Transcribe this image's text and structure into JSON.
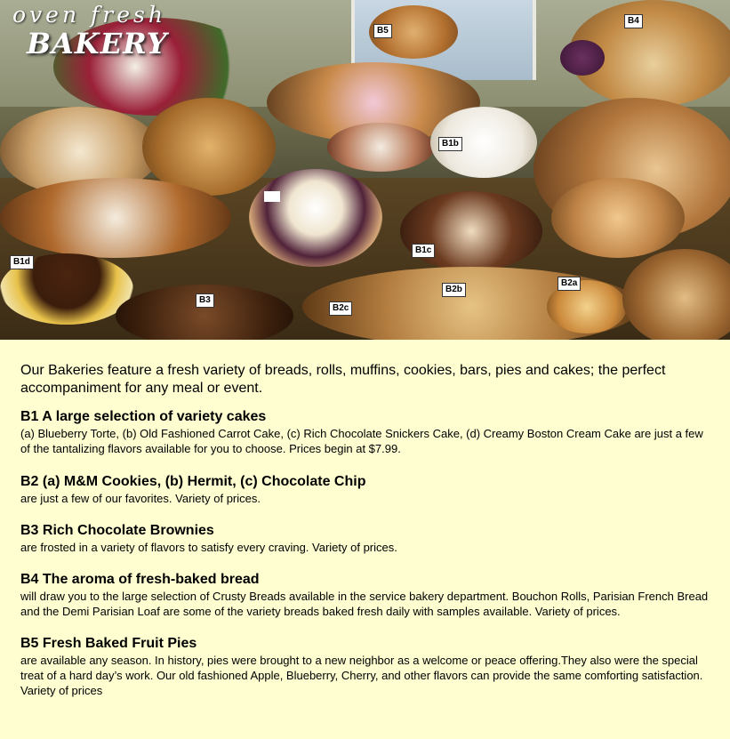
{
  "brand": {
    "line1": "oven fresh",
    "line2": "BAKERY"
  },
  "hero_labels": [
    "B5",
    "B4",
    "B1b",
    "B1c",
    "B1d",
    "B3",
    "B2c",
    "B2b",
    "B2a"
  ],
  "intro": "Our Bakeries feature a fresh variety of breads, rolls, muffins, cookies, bars, pies and cakes; the perfect accompaniment for any meal or event.",
  "sections": [
    {
      "heading": "B1 A large selection of variety cakes",
      "body": "(a) Blueberry Torte, (b) Old Fashioned Carrot Cake, (c) Rich Chocolate Snickers Cake, (d) Creamy Boston Cream Cake are just a few of the tantalizing flavors available for you to choose. Prices begin at $7.99."
    },
    {
      "heading": "B2 (a) M&M Cookies, (b) Hermit, (c) Chocolate Chip",
      "body": "are just a few of our favorites. Variety of prices."
    },
    {
      "heading": "B3 Rich Chocolate Brownies",
      "body": "are frosted in a variety of flavors to satisfy every craving. Variety of prices."
    },
    {
      "heading": "B4 The aroma of fresh-baked bread",
      "body": "will draw you to the large selection of Crusty Breads available in the service bakery department. Bouchon Rolls, Parisian French Bread and the Demi Parisian Loaf are some of the variety breads baked fresh daily with samples available. Variety of prices."
    },
    {
      "heading": "B5 Fresh Baked Fruit Pies",
      "body": "are available any season. In history, pies were brought to a new neighbor as a welcome or peace offering.They also were the special treat of a hard day’s work. Our old fashioned Apple, Blueberry, Cherry, and other flavors can provide the same comforting satisfaction. Variety of prices"
    }
  ],
  "colors": {
    "page_background": "#FEFED1",
    "text": "#000000"
  }
}
